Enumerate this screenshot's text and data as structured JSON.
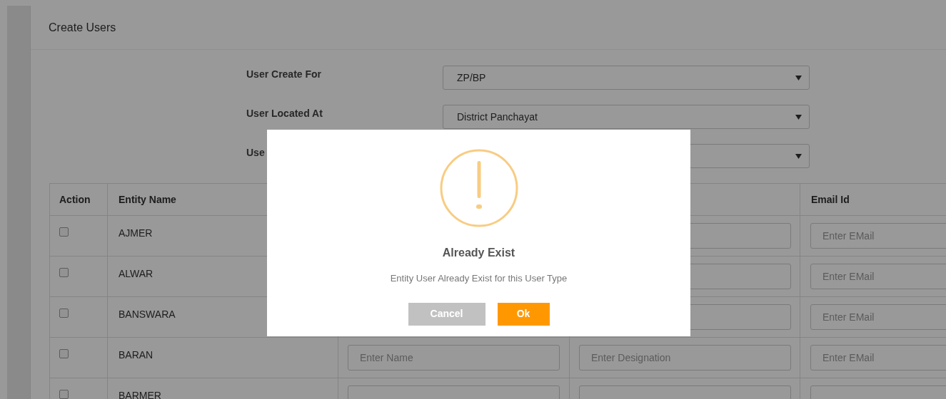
{
  "panel": {
    "title": "Create Users"
  },
  "form_fields": [
    {
      "label": "User Create For",
      "value": "ZP/BP"
    },
    {
      "label": "User Located At",
      "value": "District Panchayat"
    },
    {
      "label": "Use"
    }
  ],
  "table": {
    "headers": {
      "action": "Action",
      "entity_name": "Entity Name",
      "email": "Email Id"
    },
    "rows": [
      {
        "entity": "AJMER",
        "checked": false,
        "name_field": false,
        "email_placeholder": "Enter EMail"
      },
      {
        "entity": "ALWAR",
        "checked": false,
        "name_field": false,
        "email_placeholder": "Enter EMail"
      },
      {
        "entity": "BANSWARA",
        "checked": false,
        "name_field": false,
        "email_placeholder": "Enter EMail"
      },
      {
        "entity": "BARAN",
        "checked": false,
        "name_placeholder": "Enter Name",
        "designation_placeholder": "Enter Designation",
        "email_placeholder": "Enter EMail"
      },
      {
        "entity": "BARMER",
        "checked": false
      }
    ]
  },
  "dialog": {
    "title": "Already Exist",
    "message": "Entity User Already Exist for this User Type",
    "buttons": [
      {
        "label": "Cancel",
        "kind": "cancel"
      },
      {
        "label": "Ok",
        "kind": "confirm"
      }
    ]
  }
}
